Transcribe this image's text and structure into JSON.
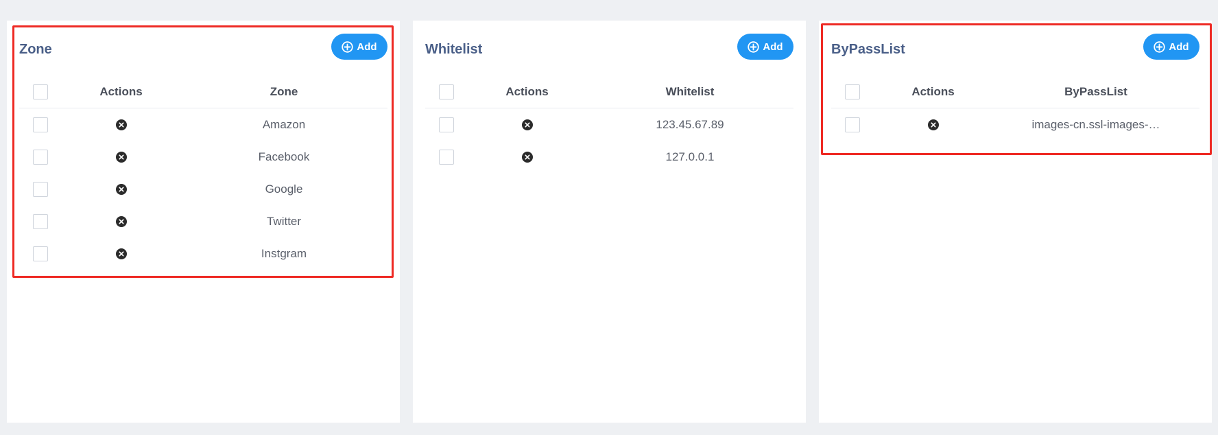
{
  "add_label": "Add",
  "accent_color": "#2196f3",
  "highlight_color": "#ee2a24",
  "panels": [
    {
      "title": "Zone",
      "columns": {
        "actions": "Actions",
        "value": "Zone"
      },
      "rows": [
        "Amazon",
        "Facebook",
        "Google",
        "Twitter",
        "Instgram"
      ]
    },
    {
      "title": "Whitelist",
      "columns": {
        "actions": "Actions",
        "value": "Whitelist"
      },
      "rows": [
        "123.45.67.89",
        "127.0.0.1"
      ]
    },
    {
      "title": "ByPassList",
      "columns": {
        "actions": "Actions",
        "value": "ByPassList"
      },
      "rows": [
        "images-cn.ssl-images-…"
      ]
    }
  ],
  "icons": {
    "add": "plus-circle-icon",
    "delete": "close-circle-icon"
  }
}
